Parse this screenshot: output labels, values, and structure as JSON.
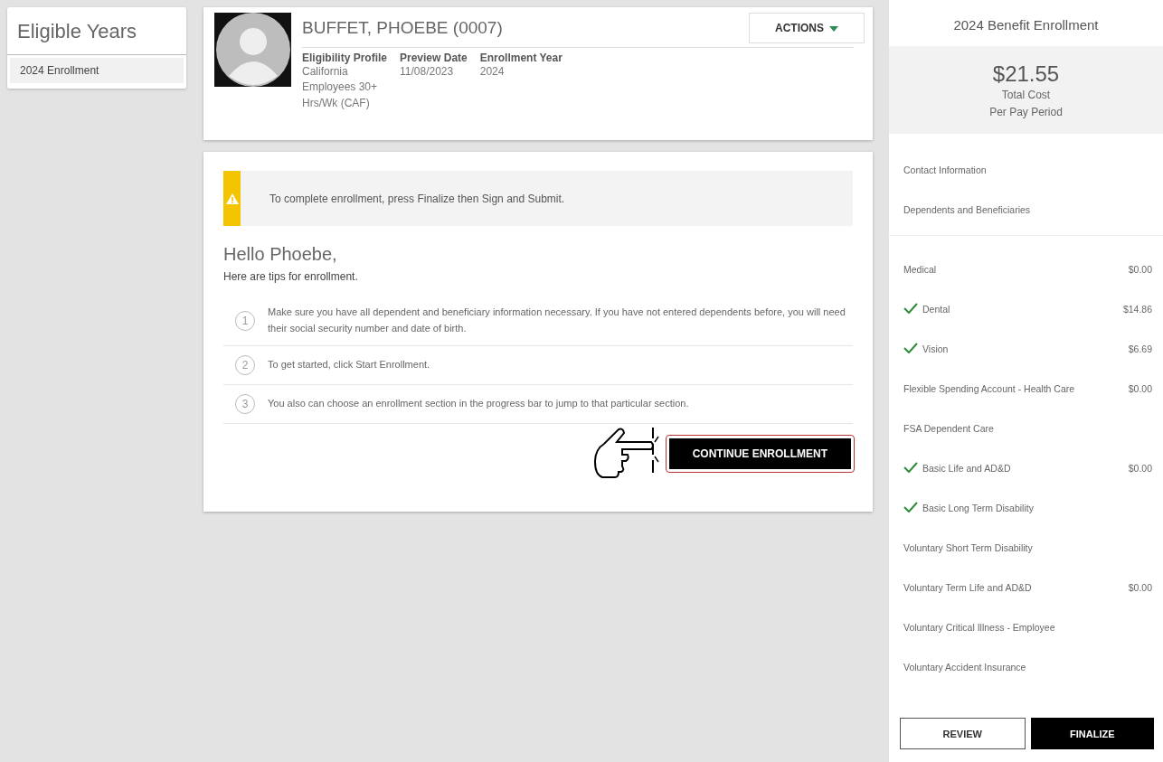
{
  "sidebar": {
    "title": "Eligible Years",
    "items": [
      {
        "label": "2024 Enrollment",
        "selected": true
      }
    ]
  },
  "profile": {
    "name": "BUFFET, PHOEBE (0007)",
    "actions_label": "ACTIONS",
    "fields": [
      {
        "label": "Eligibility Profile",
        "value": "California Employees 30+ Hrs/Wk (CAF)"
      },
      {
        "label": "Preview Date",
        "value": "11/08/2023"
      },
      {
        "label": "Enrollment Year",
        "value": "2024"
      }
    ]
  },
  "main": {
    "alert": "To complete enrollment, press Finalize then Sign and Submit.",
    "greeting": "Hello Phoebe,",
    "intro": "Here are tips for enrollment.",
    "tips": [
      {
        "number": "1",
        "text": "Make sure you have all dependent and beneficiary information necessary. If you have not entered dependents before, you will need their social security number and date of birth."
      },
      {
        "number": "2",
        "text": "To get started, click Start Enrollment."
      },
      {
        "number": "3",
        "text": "You also can choose an enrollment section in the progress bar to jump to that particular section."
      }
    ],
    "button": "CONTINUE ENROLLMENT"
  },
  "summary": {
    "title": "2024 Benefit Enrollment",
    "total": "$21.55",
    "total_label": "Total Cost",
    "period_label": "Per Pay Period",
    "sections": [
      {
        "label": "Contact Information"
      },
      {
        "label": "Dependents and Beneficiaries"
      }
    ],
    "benefits": [
      {
        "label": "Medical",
        "checked": false,
        "amount": "$0.00"
      },
      {
        "label": "Dental",
        "checked": true,
        "amount": "$14.86"
      },
      {
        "label": "Vision",
        "checked": true,
        "amount": "$6.69"
      },
      {
        "label": "Flexible Spending Account - Health Care",
        "checked": false,
        "amount": "$0.00"
      },
      {
        "label": "FSA Dependent Care",
        "checked": false
      },
      {
        "label": "Basic Life and AD&D",
        "checked": true,
        "amount": "$0.00"
      },
      {
        "label": "Basic Long Term Disability",
        "checked": true
      },
      {
        "label": "Voluntary Short Term Disability",
        "checked": false
      },
      {
        "label": "Voluntary Term Life and AD&D",
        "checked": false,
        "amount": "$0.00"
      },
      {
        "label": "Voluntary Critical Illness - Employee",
        "checked": false
      },
      {
        "label": "Voluntary Accident Insurance",
        "checked": false
      }
    ],
    "buttons": [
      {
        "label": "REVIEW",
        "kind": "outline"
      },
      {
        "label": "FINALIZE",
        "kind": "solid"
      }
    ]
  }
}
